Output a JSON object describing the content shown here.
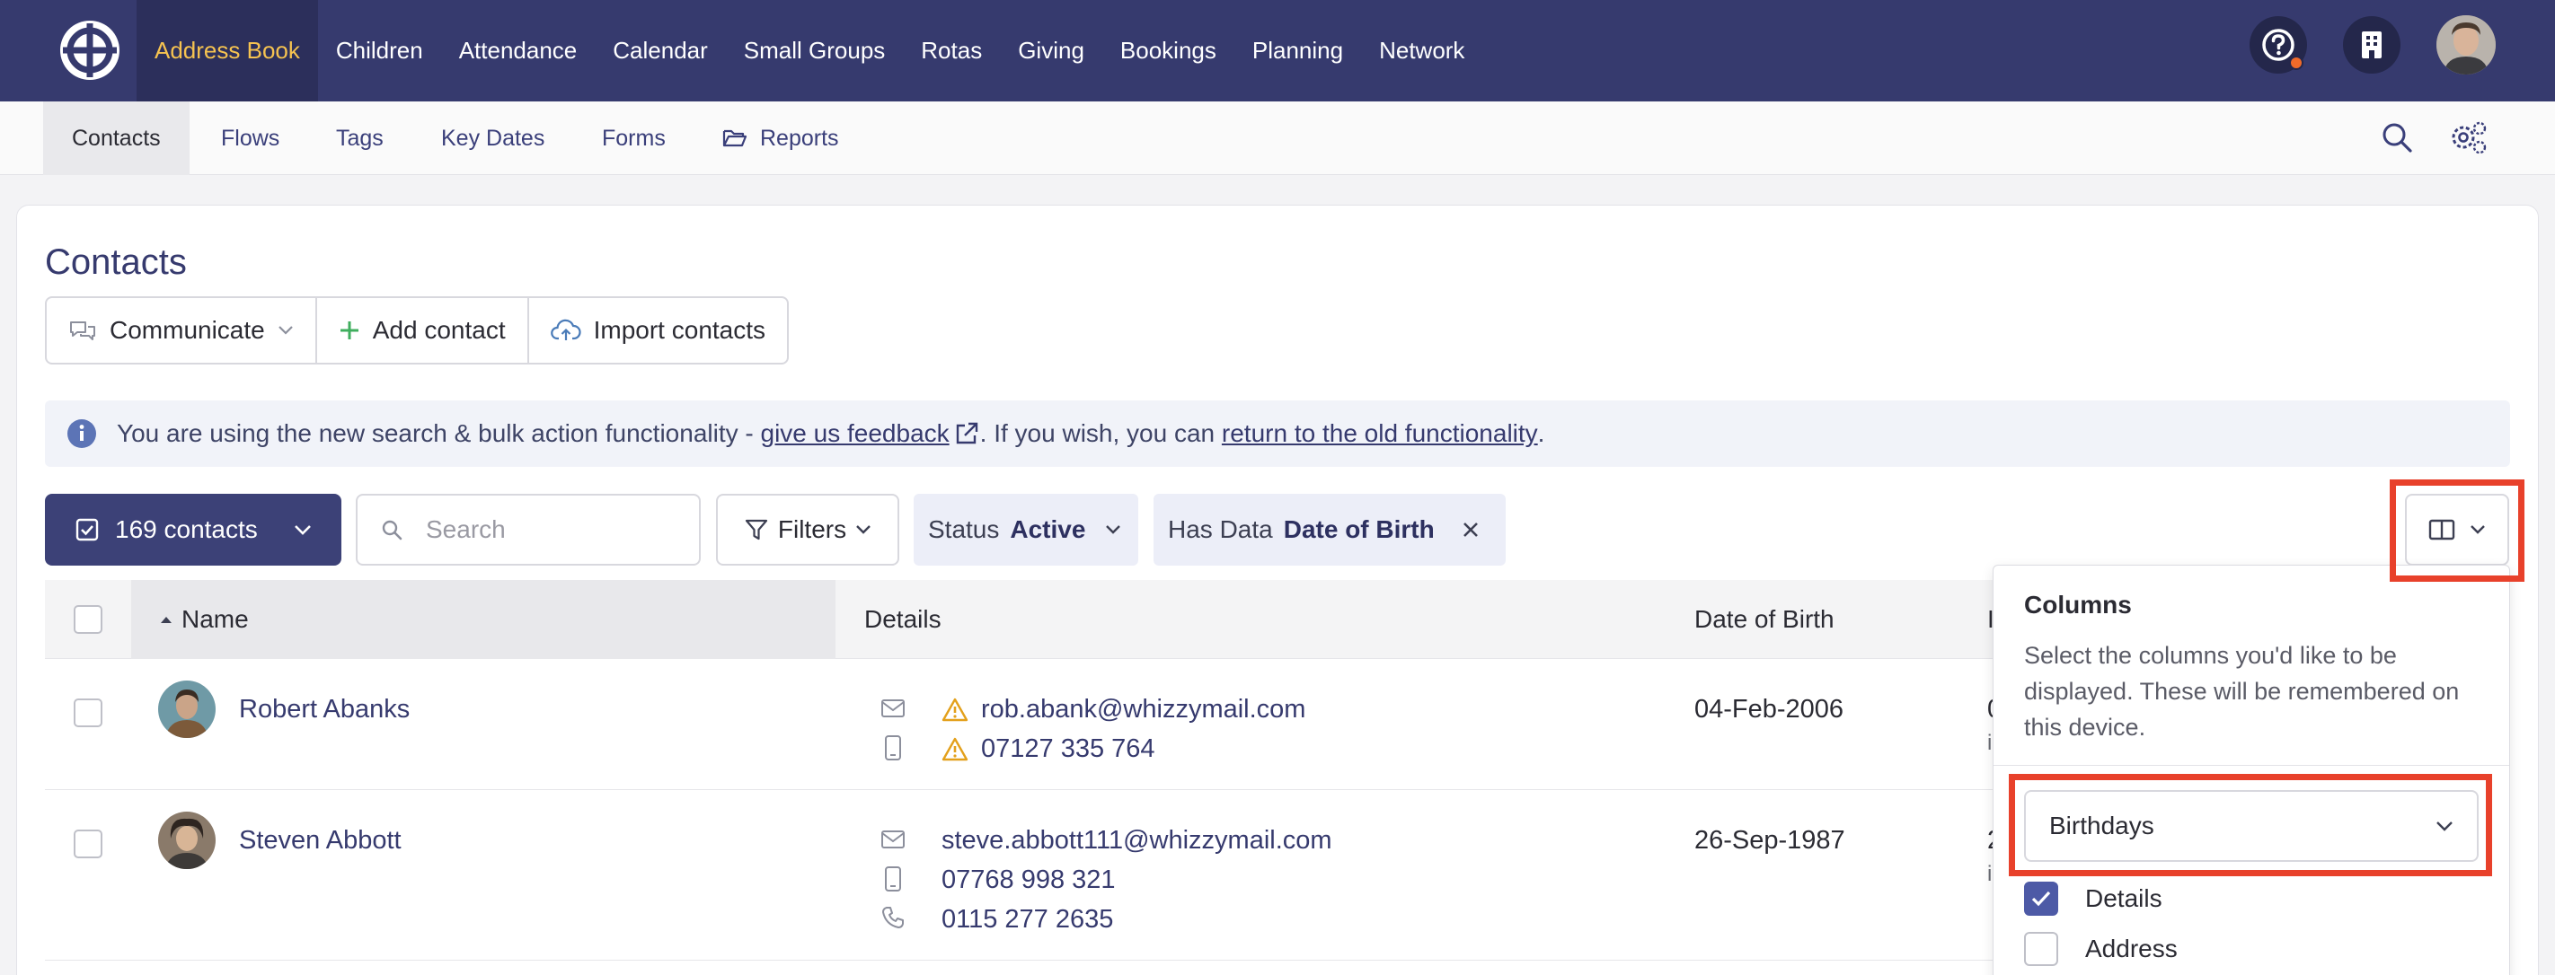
{
  "topnav": {
    "items": [
      "Address Book",
      "Children",
      "Attendance",
      "Calendar",
      "Small Groups",
      "Rotas",
      "Giving",
      "Bookings",
      "Planning",
      "Network"
    ],
    "active_index": 0
  },
  "subnav": {
    "items": [
      "Contacts",
      "Flows",
      "Tags",
      "Key Dates",
      "Forms",
      "Reports"
    ],
    "active_index": 0
  },
  "page": {
    "title": "Contacts",
    "actions": {
      "communicate": "Communicate",
      "add_contact": "Add contact",
      "import_contacts": "Import contacts"
    },
    "info": {
      "prefix": "You are using the new search & bulk action functionality - ",
      "feedback_link": "give us feedback",
      "middle": ". If you wish, you can ",
      "old_link": "return to the old functionality",
      "suffix": "."
    },
    "toolbar": {
      "contacts_count": "169 contacts",
      "search_placeholder": "Search",
      "filters": "Filters",
      "status_label": "Status",
      "status_value": "Active",
      "hasdata_label": "Has Data",
      "hasdata_value": "Date of Birth"
    }
  },
  "table": {
    "headers": {
      "name": "Name",
      "details": "Details",
      "dob": "Date of Birth"
    },
    "rows": [
      {
        "name": "Robert Abanks",
        "email": "rob.abank@whizzymail.com",
        "mobile": "07127 335 764",
        "dob": "04-Feb-2006",
        "clipped": [
          "0",
          "i"
        ],
        "warnings": true
      },
      {
        "name": "Steven Abbott",
        "email": "steve.abbott111@whizzymail.com",
        "mobile": "07768 998 321",
        "phone": "0115 277 2635",
        "dob": "26-Sep-1987",
        "clipped": [
          "2",
          "i"
        ],
        "warnings": false
      }
    ]
  },
  "columns_popup": {
    "title": "Columns",
    "description": "Select the columns you'd like to be displayed. These will be remembered on this device.",
    "preset": "Birthdays",
    "options": [
      {
        "label": "Details",
        "checked": true
      },
      {
        "label": "Address",
        "checked": false
      }
    ]
  },
  "colors": {
    "nav_bg": "#363a6e",
    "nav_active_text": "#f6c350",
    "link": "#363a6e",
    "highlight": "#e8412b",
    "warning": "#e3a01b"
  }
}
